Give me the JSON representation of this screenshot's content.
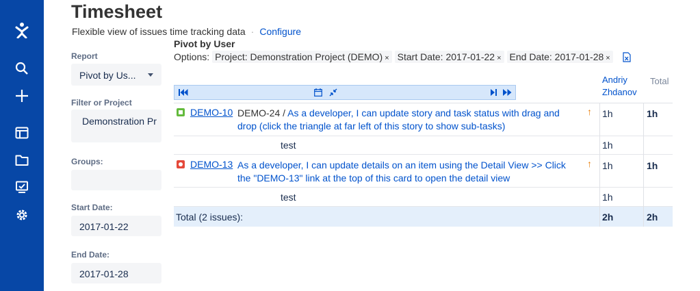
{
  "page": {
    "title": "Timesheet",
    "subtitle": "Flexible view of issues time tracking data",
    "separator": "·",
    "configure_link": "Configure"
  },
  "nav": {
    "icons": [
      "jira-logo-icon",
      "search-icon",
      "create-plus-icon",
      "boards-icon",
      "projects-icon",
      "reports-icon",
      "settings-gear-icon"
    ]
  },
  "filters": {
    "report_label": "Report",
    "report_value": "Pivot by Us...",
    "filter_label": "Filter or Project",
    "filter_value": "Demonstration Pr",
    "groups_label": "Groups:",
    "groups_value": "",
    "start_label": "Start Date:",
    "start_value": "2017-01-22",
    "end_label": "End Date:",
    "end_value": "2017-01-28"
  },
  "report": {
    "title": "Pivot by User",
    "options_label": "Options:",
    "chips": [
      {
        "text": "Project: Demonstration Project (DEMO)",
        "remove": "×"
      },
      {
        "text": "Start Date: 2017-01-22",
        "remove": "×"
      },
      {
        "text": "End Date: 2017-01-28",
        "remove": "×"
      }
    ],
    "export_icon": "excel-export-icon"
  },
  "table": {
    "columns": {
      "user_first": "Andriy",
      "user_last": "Zhdanov",
      "total": "Total"
    },
    "rows": [
      {
        "type": "story",
        "key": "DEMO-10",
        "parent": "DEMO-24",
        "parent_sep": "/",
        "summary_line1": "As a developer, I can update story and task status with drag and",
        "summary_line2": "drop (click the triangle at far left of this story to show sub-tasks)",
        "user_hours": "1h",
        "total_hours": "1h"
      },
      {
        "type": "worklog",
        "comment": "test",
        "user_hours": "1h"
      },
      {
        "type": "bug",
        "key": "DEMO-13",
        "summary_line1": "As a developer, I can update details on an item using the Detail View >> Click",
        "summary_line2": "the \"DEMO-13\" link at the top of this card to open the detail view",
        "user_hours": "1h",
        "total_hours": "1h"
      },
      {
        "type": "worklog",
        "comment": "test",
        "user_hours": "1h"
      }
    ],
    "total": {
      "label": "Total (2 issues):",
      "user_hours": "2h",
      "total_hours": "2h"
    }
  },
  "colors": {
    "nav": "#0747a6",
    "link": "#0052cc",
    "priority_arrow": "#e87a00",
    "story": "#63ba3c",
    "bug": "#e5493a"
  }
}
